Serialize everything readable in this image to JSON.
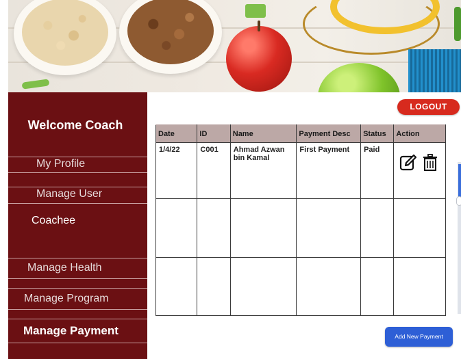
{
  "sidebar": {
    "welcome": "Welcome Coach",
    "items": [
      {
        "label": "My Profile"
      },
      {
        "label": "Manage User"
      },
      {
        "label": "Coachee"
      },
      {
        "label": "Manage Health"
      },
      {
        "label": "Manage Program"
      },
      {
        "label": "Manage Payment"
      }
    ]
  },
  "header": {
    "logout_label": "LOGOUT"
  },
  "table": {
    "headers": [
      "Date",
      "ID",
      "Name",
      "Payment Desc",
      "Status",
      "Action"
    ],
    "rows": [
      {
        "date": "1/4/22",
        "id": "C001",
        "name": "Ahmad Azwan bin Kamal",
        "desc": "First Payment",
        "status": "Paid"
      }
    ]
  },
  "footer": {
    "add_label": "Add New Payment"
  },
  "colors": {
    "sidebar_bg": "#6b1013",
    "logout_bg": "#d72a1e",
    "header_bg": "#bca8a6",
    "add_btn_bg": "#2e5fd6"
  },
  "icons": [
    "edit-icon",
    "trash-icon"
  ]
}
